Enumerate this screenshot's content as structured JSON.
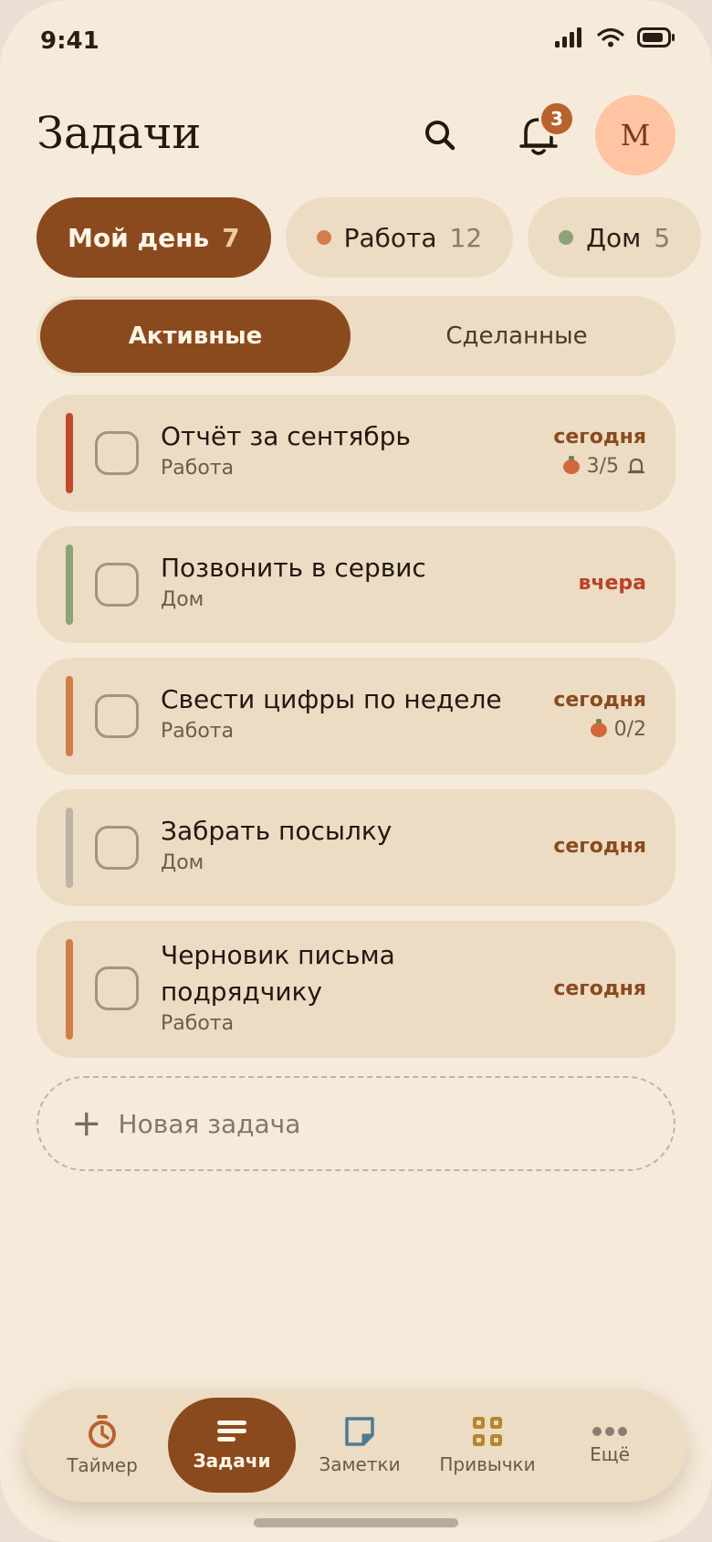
{
  "status": {
    "time": "9:41"
  },
  "header": {
    "title": "Задачи",
    "notifications_count": "3",
    "avatar_initial": "М"
  },
  "lists": [
    {
      "label": "Мой день",
      "count": "7",
      "active": true
    },
    {
      "label": "Работа",
      "count": "12",
      "dot_color": "#d47c4a"
    },
    {
      "label": "Дом",
      "count": "5",
      "dot_color": "#8ea27a"
    }
  ],
  "tabs": {
    "active": "Активные",
    "done": "Сделанные"
  },
  "tasks": [
    {
      "title": "Отчёт за сентябрь",
      "tag": "Работа",
      "due": "сегодня",
      "due_color": "#8b4a1d",
      "bar_color": "#c04a2e",
      "pomodoro": "3/5",
      "reminder": true
    },
    {
      "title": "Позвонить в сервис",
      "tag": "Дом",
      "due": "вчера",
      "due_color": "#b8432a",
      "bar_color": "#8ea27a"
    },
    {
      "title": "Свести цифры по неделе",
      "tag": "Работа",
      "due": "сегодня",
      "due_color": "#8b4a1d",
      "bar_color": "#d47c4a",
      "pomodoro": "0/2"
    },
    {
      "title": "Забрать посылку",
      "tag": "Дом",
      "due": "сегодня",
      "due_color": "#8b4a1d",
      "bar_color": "#bdb3a6"
    },
    {
      "title_line1": "Черновик письма",
      "title_line2": "подрядчику",
      "tag": "Работа",
      "due": "сегодня",
      "due_color": "#8b4a1d",
      "bar_color": "#d47c4a"
    }
  ],
  "new_task": {
    "placeholder": "Новая задача"
  },
  "nav": [
    {
      "label": "Таймер",
      "icon": "timer-icon"
    },
    {
      "label": "Задачи",
      "icon": "tasks-icon",
      "active": true
    },
    {
      "label": "Заметки",
      "icon": "notes-icon"
    },
    {
      "label": "Привычки",
      "icon": "habits-icon"
    },
    {
      "label": "Ещё",
      "icon": "more-icon"
    }
  ],
  "colors": {
    "accent": "#8b4a1d",
    "background": "#f6ebda",
    "card": "#ecdcc4"
  }
}
